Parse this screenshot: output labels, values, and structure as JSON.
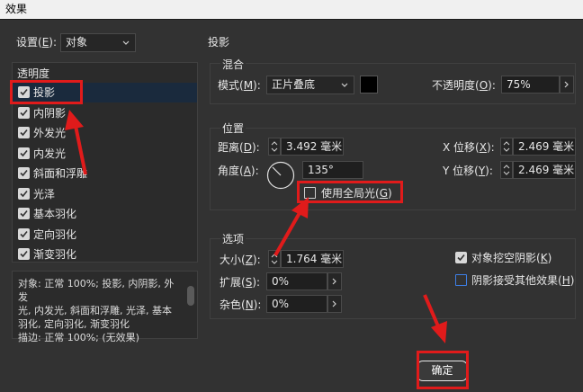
{
  "window": {
    "title": "效果"
  },
  "settings": {
    "label_prefix": "设置(",
    "key": "E",
    "label_suffix": "):",
    "value": "对象"
  },
  "transparency": {
    "header": "透明度",
    "items": [
      {
        "label": "投影",
        "checked": true,
        "selected": true
      },
      {
        "label": "内阴影",
        "checked": true
      },
      {
        "label": "外发光",
        "checked": true
      },
      {
        "label": "内发光",
        "checked": true
      },
      {
        "label": "斜面和浮雕",
        "checked": true
      },
      {
        "label": "光泽",
        "checked": true
      },
      {
        "label": "基本羽化",
        "checked": true
      },
      {
        "label": "定向羽化",
        "checked": true
      },
      {
        "label": "渐变羽化",
        "checked": true
      }
    ]
  },
  "summary": {
    "line1": "对象: 正常 100%; 投影, 内阴影, 外发",
    "line2": "光, 内发光, 斜面和浮雕, 光泽, 基本",
    "line3": "羽化, 定向羽化, 渐变羽化",
    "line4": "描边: 正常 100%; (无效果)"
  },
  "section_title": "投影",
  "blend": {
    "header": "混合",
    "mode_label": "模式(",
    "mode_key": "M",
    "mode_suffix": "):",
    "mode_value": "正片叠底",
    "swatch_color": "#000000",
    "opacity_label": "不透明度(",
    "opacity_key": "O",
    "opacity_suffix": "):",
    "opacity_value": "75%"
  },
  "position": {
    "header": "位置",
    "distance_label": "距离(",
    "distance_key": "D",
    "distance_suffix": "):",
    "distance_value": "3.492 毫米",
    "angle_label": "角度(",
    "angle_key": "A",
    "angle_suffix": "):",
    "angle_value": "135°",
    "global_light_label": "使用全局光(",
    "global_light_key": "G",
    "global_light_suffix": ")",
    "x_label": "X 位移(",
    "x_key": "X",
    "x_suffix": "):",
    "x_value": "2.469 毫米",
    "y_label": "Y 位移(",
    "y_key": "Y",
    "y_suffix": "):",
    "y_value": "2.469 毫米"
  },
  "options": {
    "header": "选项",
    "size_label": "大小(",
    "size_key": "Z",
    "size_suffix": "):",
    "size_value": "1.764 毫米",
    "spread_label": "扩展(",
    "spread_key": "S",
    "spread_suffix": "):",
    "spread_value": "0%",
    "noise_label": "杂色(",
    "noise_key": "N",
    "noise_suffix": "):",
    "noise_value": "0%",
    "knockout_label": "对象挖空阴影(",
    "knockout_key": "K",
    "knockout_suffix": ")",
    "honor_label": "阴影接受其他效果(",
    "honor_key": "H",
    "honor_suffix": ")"
  },
  "ok_label": "确定",
  "colors": {
    "annotation_red": "#e01b1b",
    "blue_checkbox": "#3d7fe6"
  }
}
